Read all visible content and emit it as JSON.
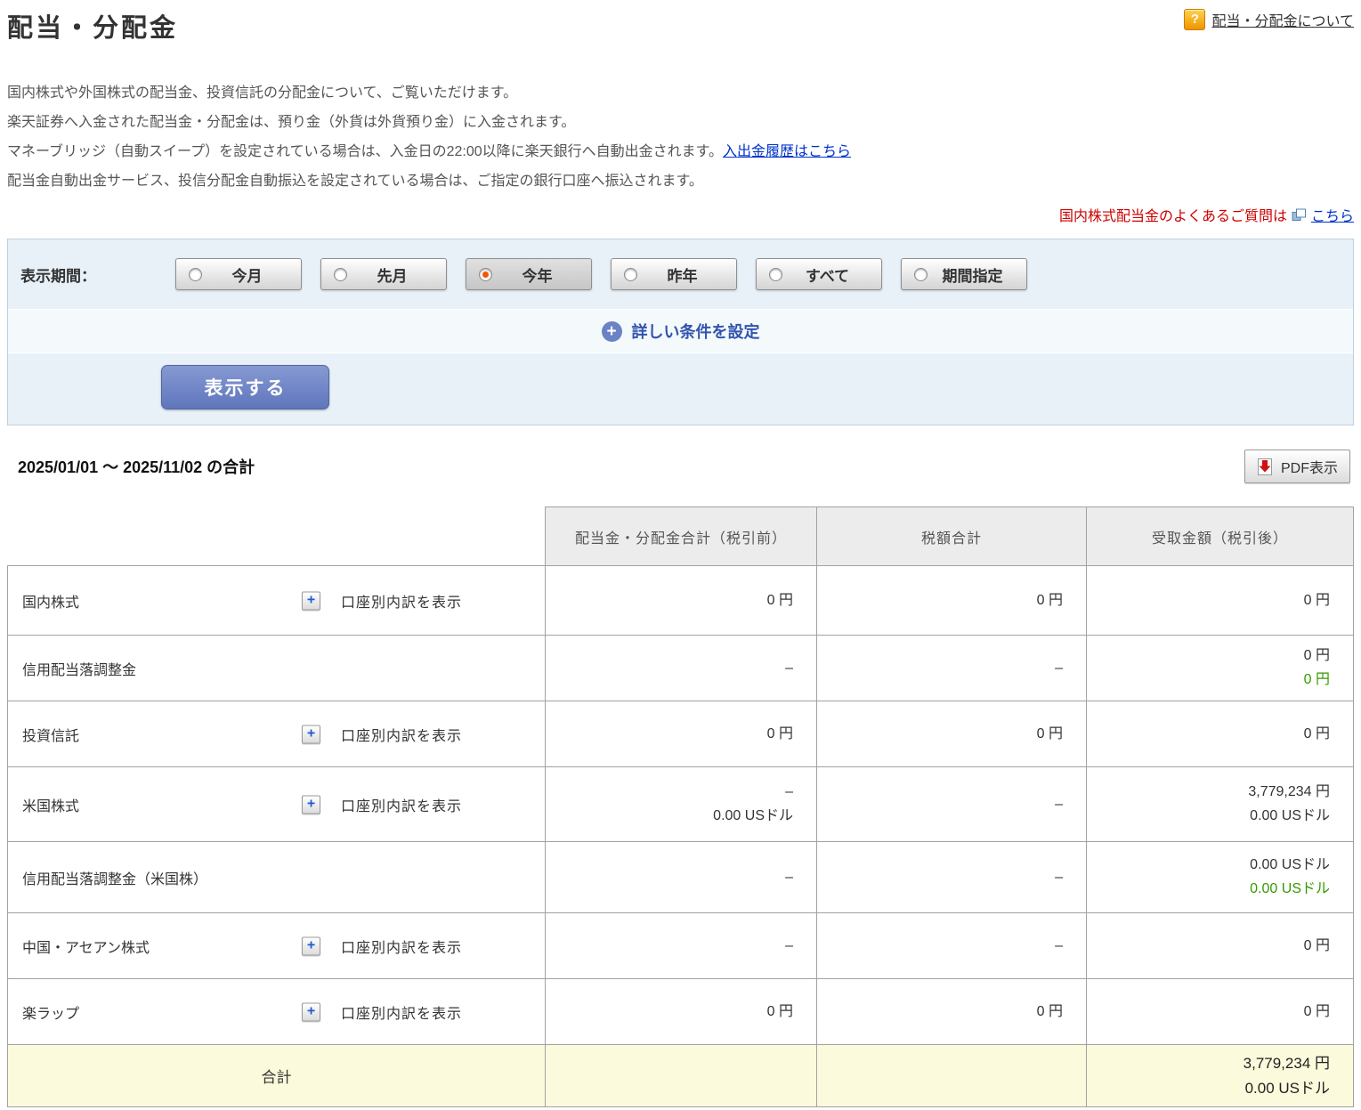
{
  "colors": {
    "accent_blue": "#6b82c4",
    "link_blue": "#0033cc",
    "alert_red": "#cc0000",
    "value_green": "#359a00",
    "total_row_bg": "#fcfadc",
    "header_cell_bg": "#ececec",
    "panel_bg": "#e8f1f8"
  },
  "icons": {
    "plus": "+",
    "help": "?"
  },
  "header": {
    "title": "配当・分配金",
    "help_link": "配当・分配金について"
  },
  "intro": {
    "line1": "国内株式や外国株式の配当金、投資信託の分配金について、ご覧いただけます。",
    "line2": "楽天証券へ入金された配当金・分配金は、預り金（外貨は外貨預り金）に入金されます。",
    "line3_text": "マネーブリッジ（自動スイープ）を設定されている場合は、入金日の22:00以降に楽天銀行へ自動出金されます。",
    "line3_link": "入出金履歴はこちら",
    "line4": "配当金自動出金サービス、投信分配金自動振込を設定されている場合は、ご指定の銀行口座へ振込されます。",
    "faq_text": "国内株式配当金のよくあるご質問は",
    "faq_link": "こちら"
  },
  "filter": {
    "label": "表示期間：",
    "options": [
      {
        "label": "今月",
        "selected": false
      },
      {
        "label": "先月",
        "selected": false
      },
      {
        "label": "今年",
        "selected": true
      },
      {
        "label": "昨年",
        "selected": false
      },
      {
        "label": "すべて",
        "selected": false
      },
      {
        "label": "期間指定",
        "selected": false
      }
    ],
    "advanced_label": "詳しい条件を設定",
    "submit_label": "表示する"
  },
  "summary": {
    "heading": "2025/01/01 ～ 2025/11/02 の合計",
    "pdf_button": "PDF表示"
  },
  "table": {
    "headers": [
      "配当金・分配金合計（税引前）",
      "税額合計",
      "受取金額（税引後）"
    ],
    "breakdown_label": "口座別内訳を表示",
    "rows": [
      {
        "label": "国内株式",
        "expandable": true,
        "cells": [
          [
            {
              "text": "0 円"
            }
          ],
          [
            {
              "text": "0 円"
            }
          ],
          [
            {
              "text": "0 円"
            }
          ]
        ]
      },
      {
        "label": "信用配当落調整金",
        "expandable": false,
        "cells": [
          [
            {
              "text": "–"
            }
          ],
          [
            {
              "text": "–"
            }
          ],
          [
            {
              "text": "0 円"
            },
            {
              "text": "0 円",
              "green": true
            }
          ]
        ]
      },
      {
        "label": "投資信託",
        "expandable": true,
        "cells": [
          [
            {
              "text": "0 円"
            }
          ],
          [
            {
              "text": "0 円"
            }
          ],
          [
            {
              "text": "0 円"
            }
          ]
        ]
      },
      {
        "label": "米国株式",
        "expandable": true,
        "cells": [
          [
            {
              "text": "–"
            },
            {
              "text": "0.00 USドル"
            }
          ],
          [
            {
              "text": "–"
            }
          ],
          [
            {
              "text": "3,779,234 円"
            },
            {
              "text": "0.00 USドル"
            }
          ]
        ]
      },
      {
        "label": "信用配当落調整金（米国株）",
        "expandable": false,
        "cells": [
          [
            {
              "text": "–"
            }
          ],
          [
            {
              "text": "–"
            }
          ],
          [
            {
              "text": "0.00 USドル"
            },
            {
              "text": "0.00 USドル",
              "green": true
            }
          ]
        ]
      },
      {
        "label": "中国・アセアン株式",
        "expandable": true,
        "cells": [
          [
            {
              "text": "–"
            }
          ],
          [
            {
              "text": "–"
            }
          ],
          [
            {
              "text": "0 円"
            }
          ]
        ]
      },
      {
        "label": "楽ラップ",
        "expandable": true,
        "cells": [
          [
            {
              "text": "0 円"
            }
          ],
          [
            {
              "text": "0 円"
            }
          ],
          [
            {
              "text": "0 円"
            }
          ]
        ]
      }
    ],
    "total": {
      "label": "合計",
      "values": [
        "3,779,234 円",
        "0.00 USドル"
      ]
    }
  }
}
